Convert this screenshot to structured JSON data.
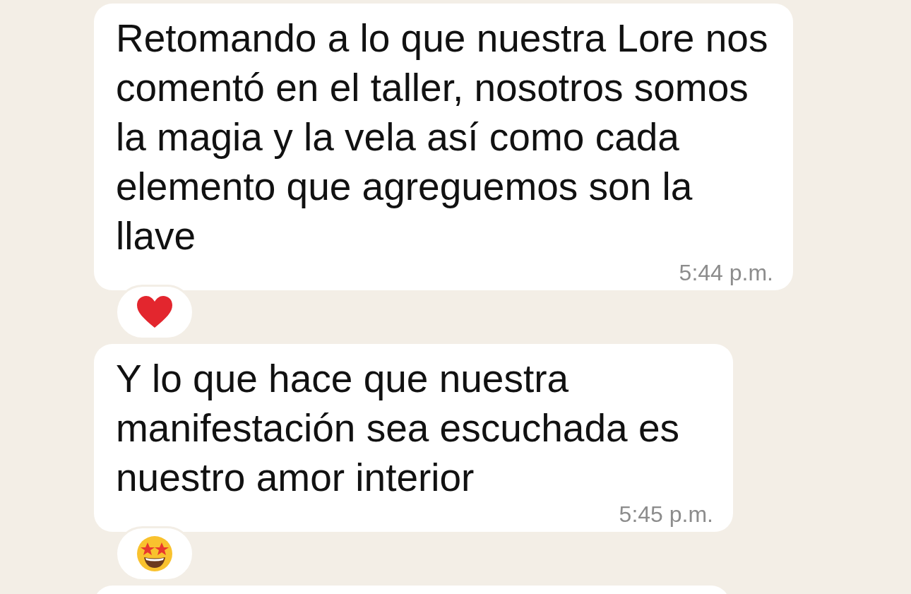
{
  "messages": [
    {
      "text": "Retomando a lo que nuestra Lore nos comentó en el taller, nosotros somos la magia y la vela así como cada elemento que agreguemos son la llave",
      "time": "5:44 p.m.",
      "reaction": {
        "kind": "heart"
      }
    },
    {
      "text": "Y lo que hace que nuestra manifestación sea escuchada es nuestro amor interior",
      "time": "5:45 p.m.",
      "reaction": {
        "kind": "star-eyes"
      }
    }
  ]
}
